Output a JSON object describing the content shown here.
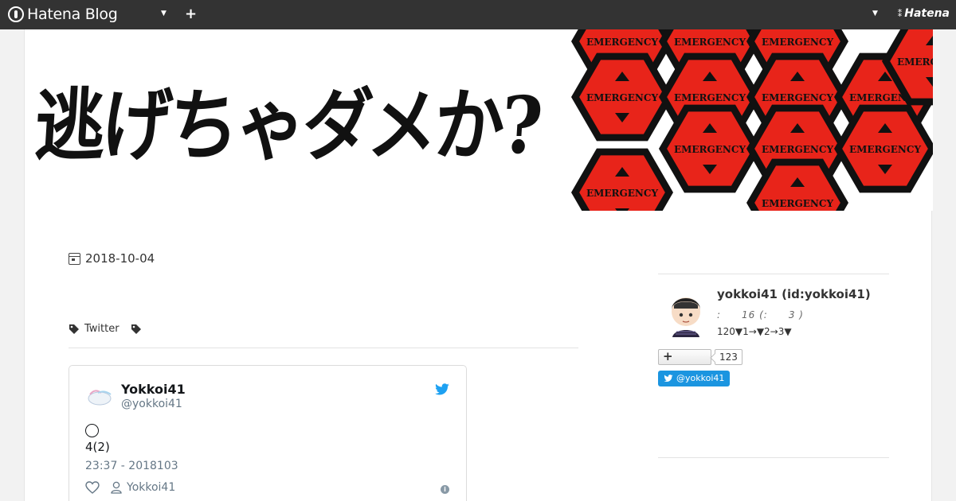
{
  "topbar": {
    "brand": "Hatena Blog",
    "hatena_label": "Hatena"
  },
  "banner": {
    "title": "逃げちゃダメか?",
    "hex_label": "EMERGENCY"
  },
  "entry": {
    "date": "2018-10-04",
    "tags": [
      "Twitter",
      ""
    ]
  },
  "tweet": {
    "name": "Yokkoi41",
    "handle": "@yokkoi41",
    "line1": "◯",
    "line2": "4(2)",
    "time": "23:37 - 2018103",
    "user_label": "Yokkoi41"
  },
  "profile": {
    "name": "yokkoi41 (id:yokkoi41)",
    "stats": ":　　16 (:　　3 )",
    "desc": "120▼1→▼2→3▼",
    "follow_count": "123",
    "twitter_label": "@yokkoi41"
  },
  "colors": {
    "topbar": "#333333",
    "hex_red": "#e8241a",
    "twitter_blue": "#1da1f2"
  }
}
